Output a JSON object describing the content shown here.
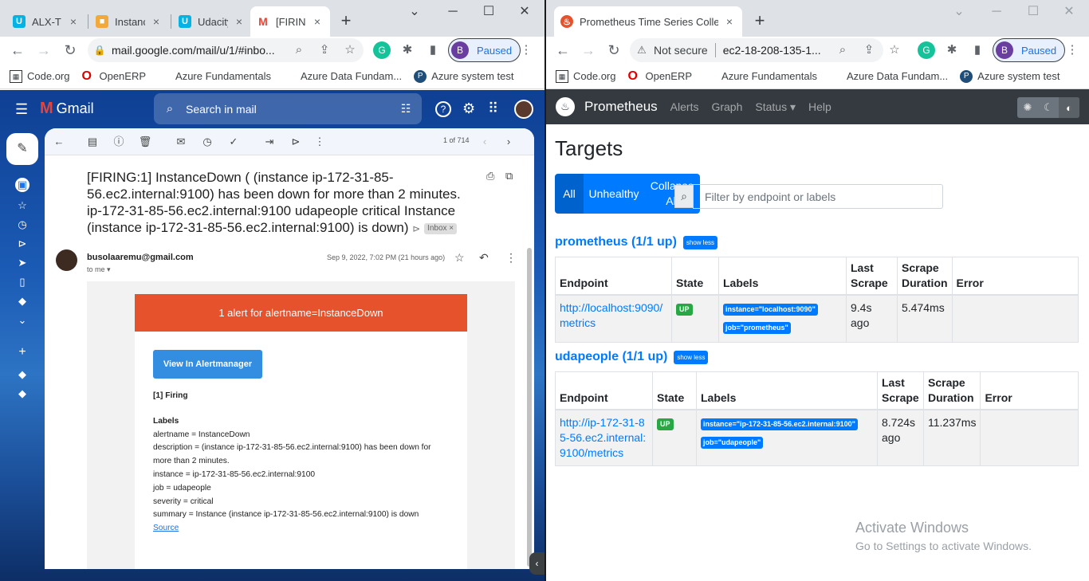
{
  "left": {
    "tabs": [
      {
        "label": "ALX-T",
        "icon": "udacity-icon",
        "color": "#02b3e4"
      },
      {
        "label": "Instanc",
        "icon": "aws-cube-icon",
        "color": "#f2a93b"
      },
      {
        "label": "Udacity",
        "icon": "udacity-icon",
        "color": "#02b3e4"
      },
      {
        "label": "[FIRING",
        "icon": "gmail-icon",
        "color": "#ea4335"
      }
    ],
    "url": "mail.google.com/mail/u/1/#inbo...",
    "profile": {
      "initial": "B",
      "status": "Paused"
    },
    "bookmarks": [
      "Code.org",
      "OpenERP",
      "Azure Fundamentals",
      "Azure Data Fundam...",
      "Azure system test"
    ]
  },
  "gmail": {
    "brand": "Gmail",
    "search_placeholder": "Search in mail",
    "pagination": "1 of 714",
    "subject": "[FIRING:1] InstanceDown ( (instance ip-172-31-85-56.ec2.internal:9100) has been down for more than 2 minutes. ip-172-31-85-56.ec2.internal:9100 udapeople critical Instance (instance ip-172-31-85-56.ec2.internal:9100) is down)",
    "inbox_chip": "Inbox ×",
    "sender": "busolaaremu@gmail.com",
    "to": "to me",
    "date": "Sep 9, 2022, 7:02 PM (21 hours ago)",
    "email": {
      "header": "1 alert for alertname=InstanceDown",
      "button": "View In Alertmanager",
      "firing": "[1] Firing",
      "labels_title": "Labels",
      "lines": [
        "alertname = InstanceDown",
        "description = (instance ip-172-31-85-56.ec2.internal:9100) has been down for",
        "more than 2 minutes.",
        "instance = ip-172-31-85-56.ec2.internal:9100",
        "job = udapeople",
        "severity = critical",
        "summary = Instance (instance ip-172-31-85-56.ec2.internal:9100) is down"
      ],
      "source": "Source"
    }
  },
  "right": {
    "tab_label": "Prometheus Time Series Collectio",
    "security": "Not secure",
    "url": "ec2-18-208-135-1...",
    "profile": {
      "initial": "B",
      "status": "Paused"
    },
    "bookmarks": [
      "Code.org",
      "OpenERP",
      "Azure Fundamentals",
      "Azure Data Fundam...",
      "Azure system test"
    ]
  },
  "prometheus": {
    "brand": "Prometheus",
    "nav": [
      "Alerts",
      "Graph",
      "Status",
      "Help"
    ],
    "title": "Targets",
    "filters": [
      "All",
      "Unhealthy",
      "Collapse All"
    ],
    "filter_placeholder": "Filter by endpoint or labels",
    "show_less": "show less",
    "columns": [
      "Endpoint",
      "State",
      "Labels",
      "Last Scrape",
      "Scrape Duration",
      "Error"
    ],
    "pools": [
      {
        "title": "prometheus (1/1 up)",
        "endpoint": "http://localhost:9090/metrics",
        "state": "UP",
        "labels": [
          "instance=\"localhost:9090\"",
          "job=\"prometheus\""
        ],
        "last_scrape": "9.4s ago",
        "duration": "5.474ms",
        "error": ""
      },
      {
        "title": "udapeople (1/1 up)",
        "endpoint": "http://ip-172-31-85-56.ec2.internal:9100/metrics",
        "state": "UP",
        "labels": [
          "instance=\"ip-172-31-85-56.ec2.internal:9100\"",
          "job=\"udapeople\""
        ],
        "last_scrape": "8.724s ago",
        "duration": "11.237ms",
        "error": ""
      }
    ]
  },
  "watermark": {
    "title": "Activate Windows",
    "subtitle": "Go to Settings to activate Windows."
  }
}
